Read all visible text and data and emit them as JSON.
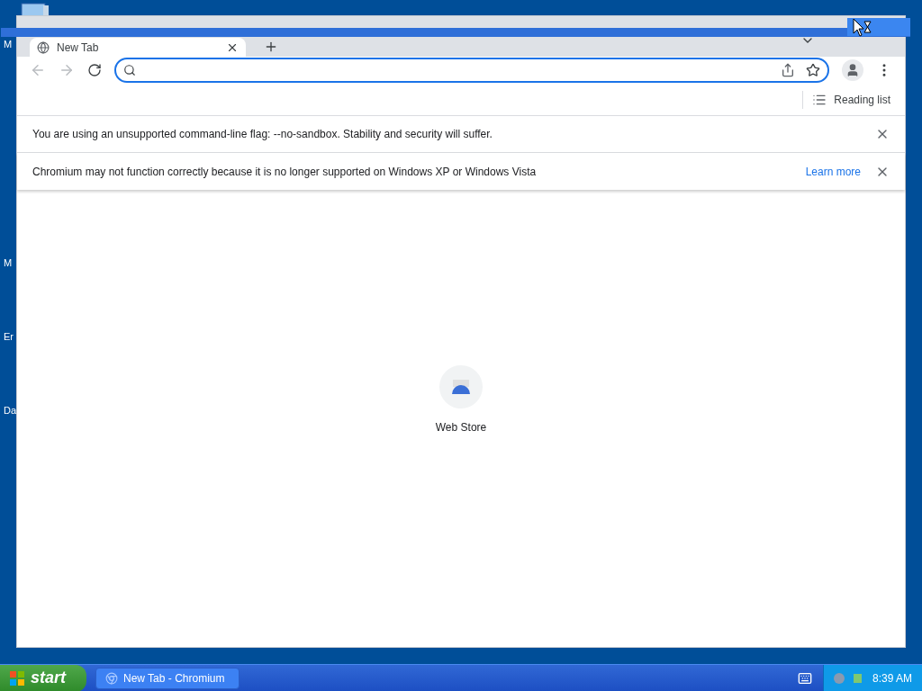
{
  "desktop_icons": [
    {
      "label": "M"
    },
    {
      "label": "M"
    },
    {
      "label": "Er"
    },
    {
      "label": "Da"
    }
  ],
  "tabs": [
    {
      "title": "New Tab",
      "selected": true
    }
  ],
  "bookmarks_bar": {
    "reading_list": "Reading list"
  },
  "infobars": [
    {
      "message": "You are using an unsupported command-line flag: --no-sandbox. Stability and security will suffer."
    },
    {
      "message": "Chromium may not function correctly because it is no longer supported on Windows XP or Windows Vista",
      "link": "Learn more"
    }
  ],
  "shortcuts": [
    {
      "label": "Web Store"
    }
  ],
  "taskbar": {
    "start": "start",
    "tasks": [
      {
        "title": "New Tab - Chromium",
        "selected": false
      }
    ],
    "clock": "8:39 AM"
  }
}
